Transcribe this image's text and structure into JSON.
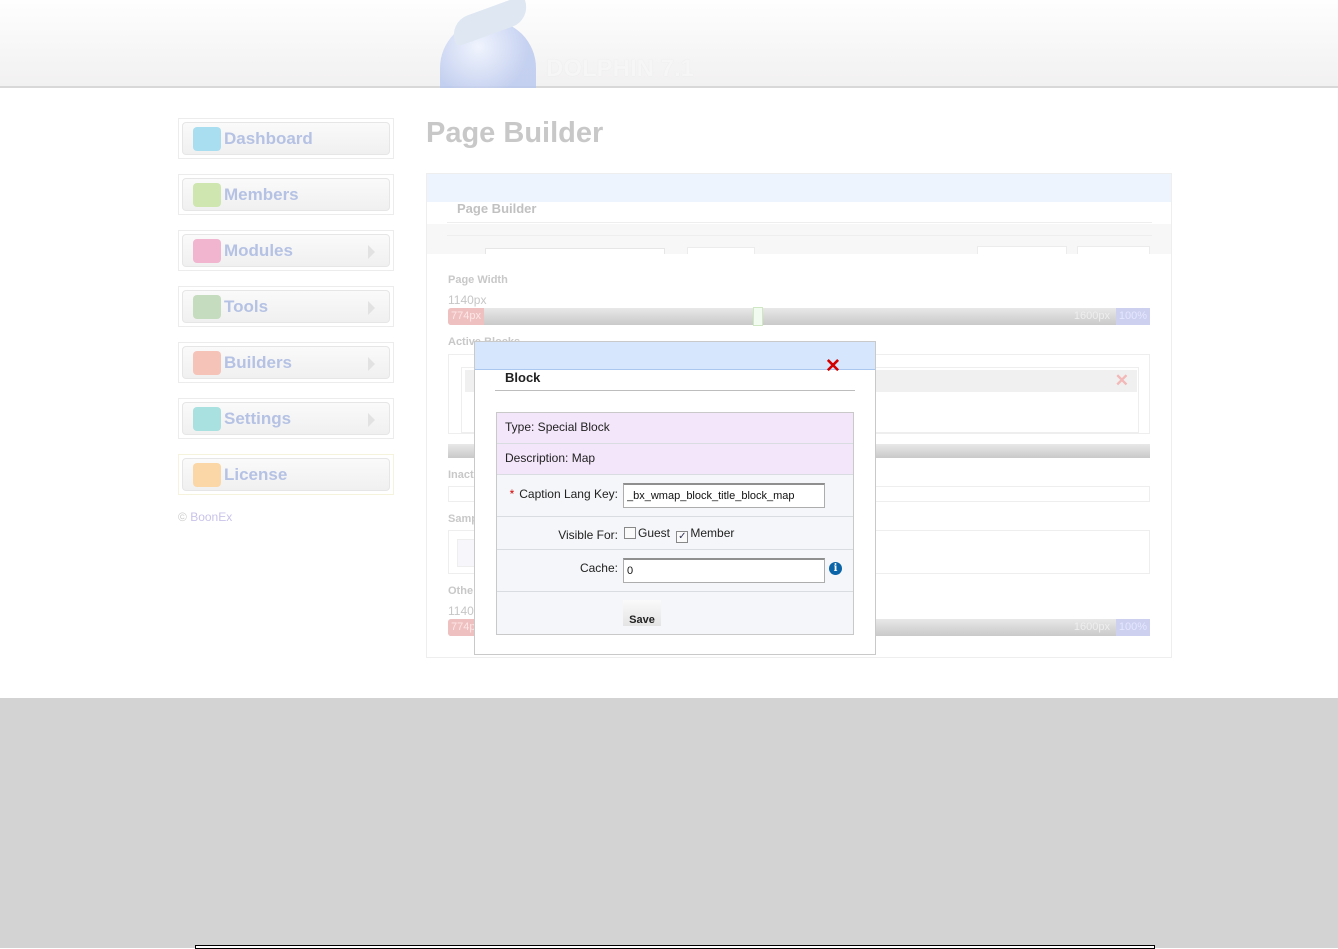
{
  "header": {
    "logo_text": "DOLPHIN 7.1"
  },
  "sidebar": {
    "items": [
      {
        "label": "Dashboard",
        "icon": "dashboard-icon",
        "color": "#a9def0",
        "arrow": false
      },
      {
        "label": "Members",
        "icon": "members-icon",
        "color": "#cfe6b0",
        "arrow": false
      },
      {
        "label": "Modules",
        "icon": "modules-icon",
        "color": "#f1b5cf",
        "arrow": true
      },
      {
        "label": "Tools",
        "icon": "wrench-icon",
        "color": "#c6dcbe",
        "arrow": true
      },
      {
        "label": "Builders",
        "icon": "builders-icon",
        "color": "#f6c3b9",
        "arrow": true
      },
      {
        "label": "Settings",
        "icon": "gears-icon",
        "color": "#a9e0e0",
        "arrow": true
      },
      {
        "label": "License",
        "icon": "key-icon",
        "color": "#fbd7a8",
        "arrow": false
      }
    ],
    "copyright_symbol": "©",
    "copyright": "BoonEx"
  },
  "page": {
    "title": "Page Builder",
    "panel_title": "Page Builder",
    "page_width_label": "Page Width",
    "page_width_value": "1140px",
    "slider": {
      "min": "774px",
      "max": "1600px",
      "pct": "100%"
    },
    "active_blocks_label": "Active Blocks",
    "inactive_fragment": "Inact",
    "samples_fragment": "Samp",
    "other_fragment": "Othe",
    "other_value_fragment": "1140"
  },
  "modal": {
    "title": "Block",
    "close": "✕",
    "type": "Type: Special Block",
    "description": "Description: Map",
    "caption_label": "Caption Lang Key:",
    "required": "*",
    "caption_value": "_bx_wmap_block_title_block_map",
    "visible_label": "Visible For:",
    "guest": "Guest",
    "guest_checked": false,
    "member": "Member",
    "member_checked": true,
    "cache_label": "Cache:",
    "cache_value": "0",
    "info": "i",
    "save": "Save"
  }
}
